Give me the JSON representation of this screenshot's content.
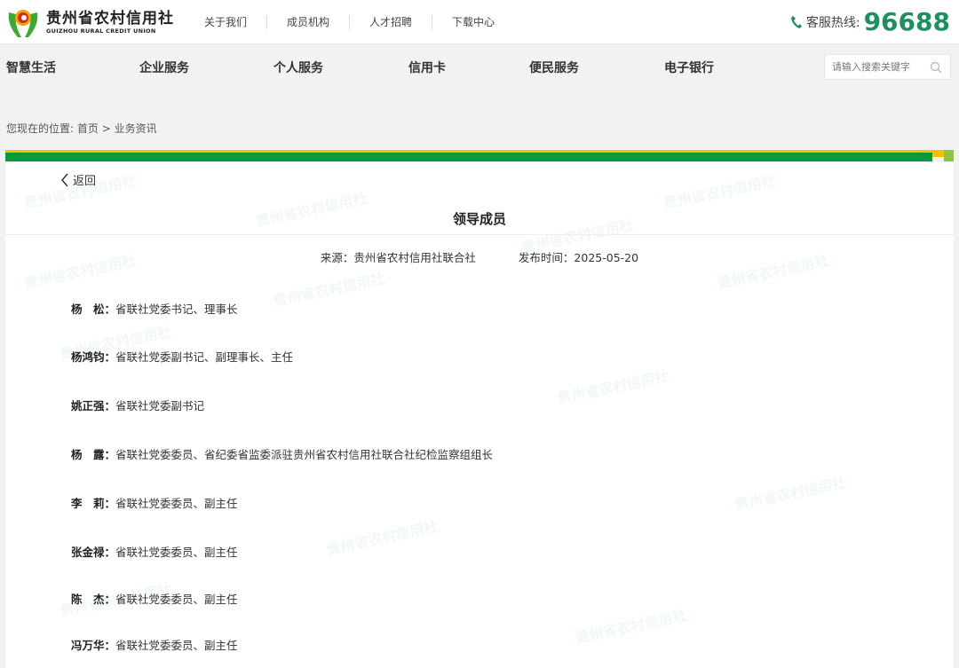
{
  "header": {
    "logo_cn": "贵州省农村信用社",
    "logo_en": "GUIZHOU RURAL CREDIT UNION",
    "links": [
      "关于我们",
      "成员机构",
      "人才招聘",
      "下载中心"
    ],
    "hotline_label": "客服热线:",
    "hotline_number": "96688"
  },
  "nav": {
    "items": [
      "智慧生活",
      "企业服务",
      "个人服务",
      "信用卡",
      "便民服务",
      "电子银行"
    ],
    "search_placeholder": "请输入搜索关键字"
  },
  "breadcrumb": {
    "prefix": "您现在的位置:",
    "home": "首页",
    "sep": ">",
    "current": "业务资讯"
  },
  "article": {
    "back": "返回",
    "title": "领导成员",
    "source": "来源：贵州省农村信用社联合社",
    "date": "发布时间：2025-05-20",
    "people": [
      {
        "name": "杨　松：",
        "role": "省联社党委书记、理事长"
      },
      {
        "name": "杨鸿钧：",
        "role": "省联社党委副书记、副理事长、主任"
      },
      {
        "name": "姚正强：",
        "role": "省联社党委副书记"
      },
      {
        "name": "杨　露：",
        "role": "省联社党委委员、省纪委省监委派驻贵州省农村信用社联合社纪检监察组组长"
      },
      {
        "name": "李　莉：",
        "role": "省联社党委委员、副主任"
      },
      {
        "name": "张金禄：",
        "role": "省联社党委委员、副主任"
      },
      {
        "name": "陈　杰：",
        "role": "省联社党委委员、副主任"
      },
      {
        "name": "冯万华：",
        "role": "省联社党委委员、副主任"
      }
    ]
  },
  "colors": {
    "brand_green": "#0a9a3c",
    "hotline": "#1e8f5e",
    "accent_yellow": "#f5c000"
  }
}
